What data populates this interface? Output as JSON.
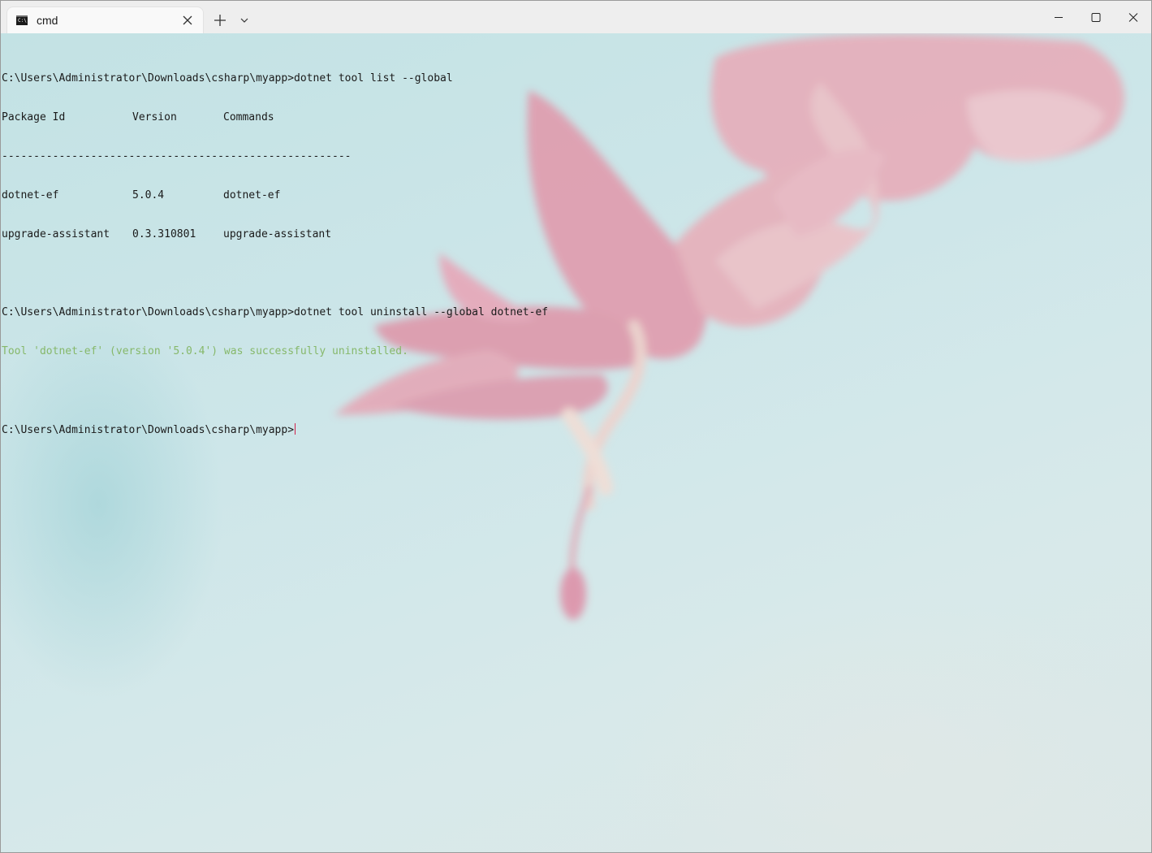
{
  "tab": {
    "title": "cmd",
    "icon": "cmd-icon"
  },
  "titlebar": {
    "new_tab_icon": "plus-icon",
    "dropdown_icon": "chevron-down-icon",
    "minimize_icon": "minimize-icon",
    "maximize_icon": "maximize-icon",
    "close_icon": "close-icon"
  },
  "console": {
    "cmd1": "C:\\Users\\Administrator\\Downloads\\csharp\\myapp>dotnet tool list --global",
    "headers": [
      "Package Id",
      "Version",
      "Commands"
    ],
    "separator": "-------------------------------------------------------",
    "rows": [
      [
        "dotnet-ef",
        "5.0.4",
        "dotnet-ef"
      ],
      [
        "upgrade-assistant",
        "0.3.310801",
        "upgrade-assistant"
      ]
    ],
    "cmd2": "C:\\Users\\Administrator\\Downloads\\csharp\\myapp>dotnet tool uninstall --global dotnet-ef",
    "success": "Tool 'dotnet-ef' (version '5.0.4') was successfully uninstalled.",
    "prompt": "C:\\Users\\Administrator\\Downloads\\csharp\\myapp>"
  },
  "colors": {
    "success_text": "#86b86a",
    "cursor": "#d0204a",
    "background": "#cfe6e8",
    "flower": "#e8a0b0"
  }
}
